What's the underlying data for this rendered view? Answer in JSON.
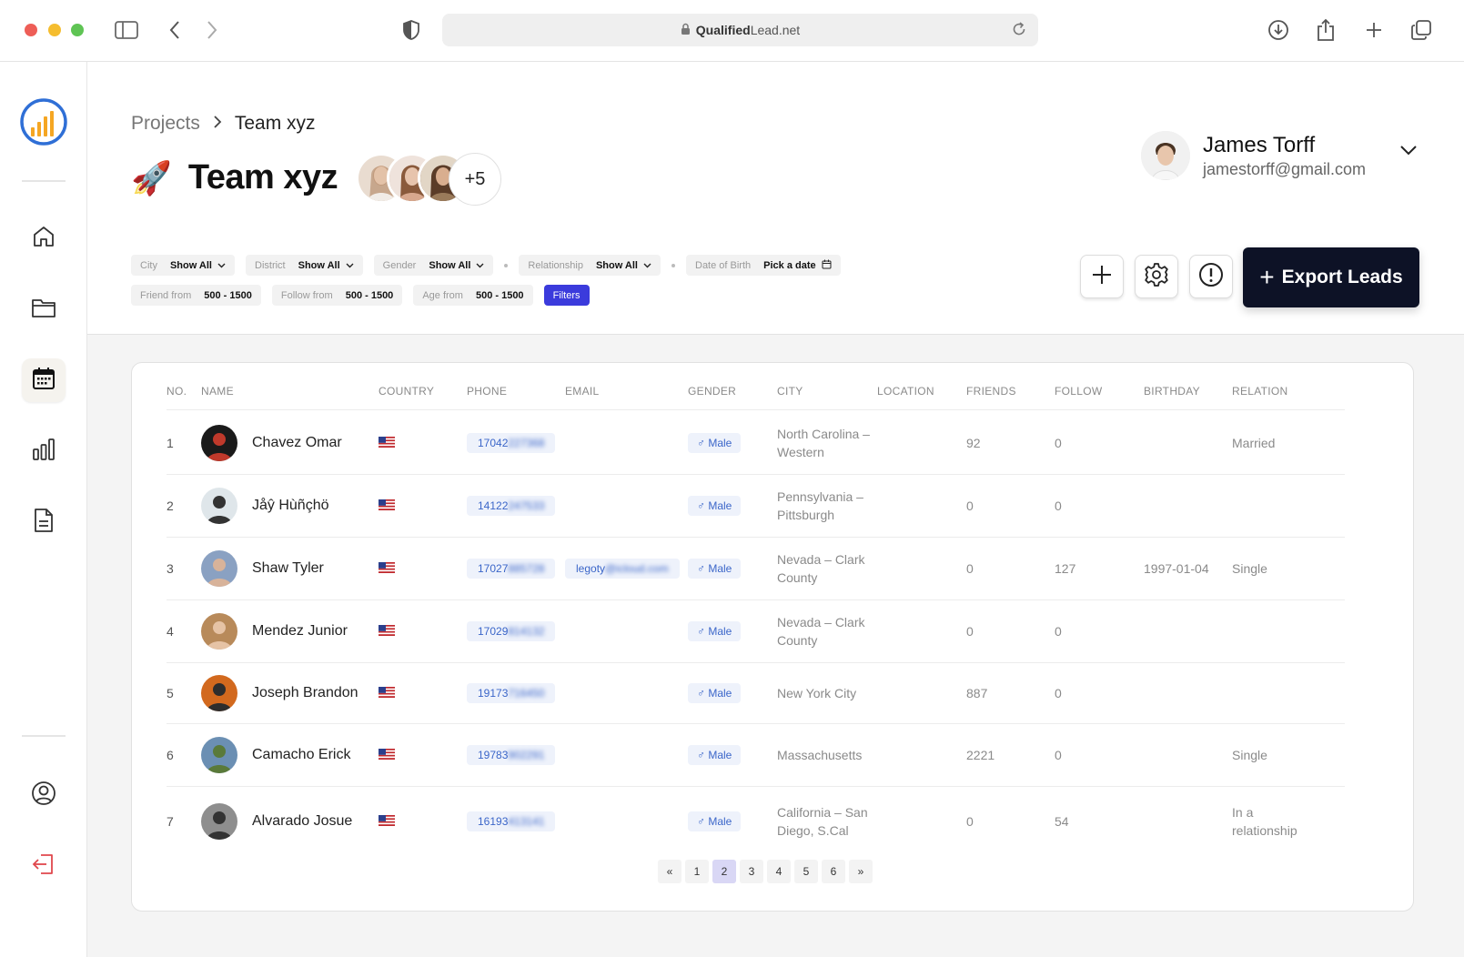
{
  "browser": {
    "address_bold": "Qualified",
    "address_rest": "Lead.net"
  },
  "breadcrumb": {
    "root": "Projects",
    "current": "Team xyz"
  },
  "page": {
    "title": "Team xyz",
    "icon": "rocket",
    "members_more": "+5"
  },
  "user": {
    "name": "James Torff",
    "email": "jamestorff@gmail.com"
  },
  "filters": {
    "row1": [
      {
        "label": "City",
        "value": "Show All",
        "caret": true
      },
      {
        "label": "District",
        "value": "Show All",
        "caret": true
      },
      {
        "label": "Gender",
        "value": "Show All",
        "caret": true
      },
      {
        "label": "Relationship",
        "value": "Show All",
        "caret": true
      },
      {
        "label": "Date of Birth",
        "value": "Pick a date",
        "caret": false
      }
    ],
    "row2": [
      {
        "label": "Friend from",
        "value": "500 - 1500"
      },
      {
        "label": "Follow from",
        "value": "500 - 1500"
      },
      {
        "label": "Age from",
        "value": "500 - 1500"
      }
    ],
    "filters_button": "Filters"
  },
  "actions": {
    "export_label": "Export Leads"
  },
  "table": {
    "headers": {
      "no": "NO.",
      "name": "NAME",
      "country": "COUNTRY",
      "phone": "PHONE",
      "email": "EMAIL",
      "gender": "GENDER",
      "city": "CITY",
      "location": "LOCATION",
      "friends": "FRIENDS",
      "follow": "FOLLOW",
      "birthday": "BIRTHDAY",
      "relation": "RELATION"
    },
    "rows": [
      {
        "no": "1",
        "name": "Chavez Omar",
        "phone_visible": "17042",
        "phone_blur": "227368",
        "email_visible": "",
        "email_blur": "",
        "gender": "Male",
        "city": "North Carolina – Western",
        "friends": "92",
        "follow": "0",
        "birthday": "",
        "relation": "Married"
      },
      {
        "no": "2",
        "name": "Jåŷ Hùñçhö",
        "phone_visible": "14122",
        "phone_blur": "247533",
        "email_visible": "",
        "email_blur": "",
        "gender": "Male",
        "city": "Pennsylvania – Pittsburgh",
        "friends": "0",
        "follow": "0",
        "birthday": "",
        "relation": ""
      },
      {
        "no": "3",
        "name": "Shaw Tyler",
        "phone_visible": "17027",
        "phone_blur": "885728",
        "email_visible": "legoty",
        "email_blur": "@icloud.com",
        "gender": "Male",
        "city": "Nevada – Clark County",
        "friends": "0",
        "follow": "127",
        "birthday": "1997-01-04",
        "relation": "Single"
      },
      {
        "no": "4",
        "name": "Mendez Junior",
        "phone_visible": "17029",
        "phone_blur": "814132",
        "email_visible": "",
        "email_blur": "",
        "gender": "Male",
        "city": "Nevada – Clark County",
        "friends": "0",
        "follow": "0",
        "birthday": "",
        "relation": ""
      },
      {
        "no": "5",
        "name": "Joseph Brandon",
        "phone_visible": "19173",
        "phone_blur": "716450",
        "email_visible": "",
        "email_blur": "",
        "gender": "Male",
        "city": "New York City",
        "friends": "887",
        "follow": "0",
        "birthday": "",
        "relation": ""
      },
      {
        "no": "6",
        "name": "Camacho Erick",
        "phone_visible": "19783",
        "phone_blur": "902291",
        "email_visible": "",
        "email_blur": "",
        "gender": "Male",
        "city": "Massachusetts",
        "friends": "2221",
        "follow": "0",
        "birthday": "",
        "relation": "Single"
      },
      {
        "no": "7",
        "name": "Alvarado Josue",
        "phone_visible": "16193",
        "phone_blur": "413141",
        "email_visible": "",
        "email_blur": "",
        "gender": "Male",
        "city": "California – San Diego, S.Cal",
        "friends": "0",
        "follow": "54",
        "birthday": "",
        "relation": "In a relationship"
      }
    ]
  },
  "pagination": {
    "prev": "«",
    "pages": [
      "1",
      "2",
      "3",
      "4",
      "5",
      "6"
    ],
    "current": "2",
    "next": "»"
  },
  "colors": {
    "accent": "#3b3bdc",
    "export_bg": "#0d1226",
    "chip_blue": "#3b66c9",
    "logo_orange": "#f5a623",
    "logo_blue": "#2f6fd6",
    "logout_red": "#e0474c"
  }
}
